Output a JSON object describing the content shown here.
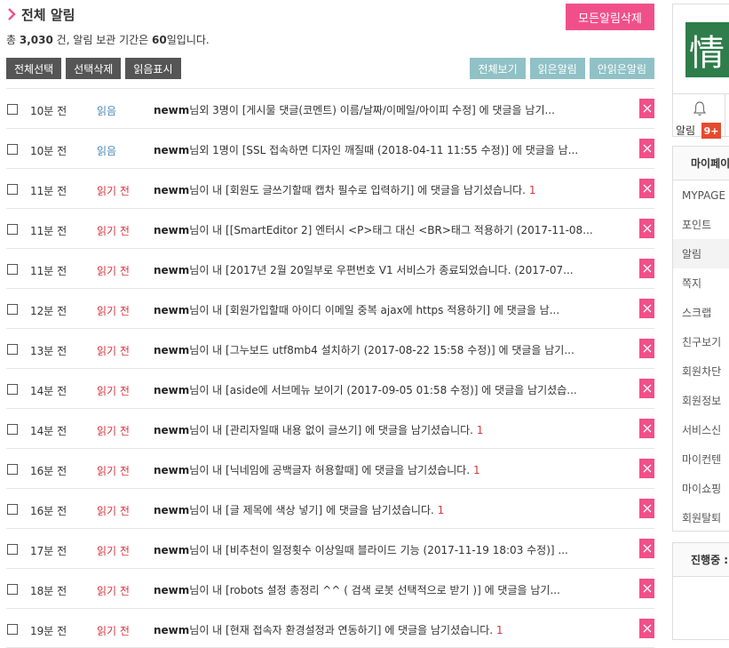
{
  "header": {
    "title": "전체 알림",
    "delete_all_label": "모든알림삭제"
  },
  "summary": {
    "prefix": "총 ",
    "count": "3,030",
    "middle": " 건, 알림 보관 기간은 ",
    "days": "60",
    "suffix": "일입니다."
  },
  "toolbar": {
    "select_all": "전체선택",
    "delete_selected": "선택삭제",
    "mark_read": "읽음표시",
    "view_all": "전체보기",
    "read_filter": "읽은알림",
    "unread_filter": "안읽은알림"
  },
  "colors": {
    "accent_pink": "#f0508a",
    "teal_button": "#8fc1c6",
    "dark_button": "#555555",
    "read_status": "#4a8ab8",
    "unread_status": "#d9363e",
    "logo_green": "#2e7d4a"
  },
  "notifications": [
    {
      "time": "10분 전",
      "status": "읽음",
      "read": true,
      "nick": "newm",
      "text": "님외 3명이 [게시물 댓글(코멘트) 이름/날짜/이메일/아이피 수정] 에 댓글을 남기...",
      "count": ""
    },
    {
      "time": "10분 전",
      "status": "읽음",
      "read": true,
      "nick": "newm",
      "text": "님외 1명이 [SSL 접속하면 디자인 깨질때 (2018-04-11 11:55 수정)] 에 댓글을 남...",
      "count": ""
    },
    {
      "time": "11분 전",
      "status": "읽기 전",
      "read": false,
      "nick": "newm",
      "text": "님이 내 [회원도 글쓰기할때 캡차 필수로 입력하기] 에 댓글을 남기셨습니다. ",
      "count": "1"
    },
    {
      "time": "11분 전",
      "status": "읽기 전",
      "read": false,
      "nick": "newm",
      "text": "님이 내 [[SmartEditor 2] 엔터시 <P>태그 대신 <BR>태그 적용하기 (2017-11-08...",
      "count": ""
    },
    {
      "time": "11분 전",
      "status": "읽기 전",
      "read": false,
      "nick": "newm",
      "text": "님이 내 [2017년 2월 20일부로 우편번호 V1 서비스가 종료되었습니다. (2017-07...",
      "count": ""
    },
    {
      "time": "12분 전",
      "status": "읽기 전",
      "read": false,
      "nick": "newm",
      "text": "님이 내 [회원가입할때 아이디 이메일 중복 ajax에 https 적용하기] 에 댓글을 남...",
      "count": ""
    },
    {
      "time": "13분 전",
      "status": "읽기 전",
      "read": false,
      "nick": "newm",
      "text": "님이 내 [그누보드 utf8mb4 설치하기 (2017-08-22 15:58 수정)] 에 댓글을 남기...",
      "count": ""
    },
    {
      "time": "14분 전",
      "status": "읽기 전",
      "read": false,
      "nick": "newm",
      "text": "님이 내 [aside에 서브메뉴 보이기 (2017-09-05 01:58 수정)] 에 댓글을 남기셨습...",
      "count": ""
    },
    {
      "time": "14분 전",
      "status": "읽기 전",
      "read": false,
      "nick": "newm",
      "text": "님이 내 [관리자일때 내용 없이 글쓰기] 에 댓글을 남기셨습니다. ",
      "count": "1"
    },
    {
      "time": "16분 전",
      "status": "읽기 전",
      "read": false,
      "nick": "newm",
      "text": "님이 내 [닉네임에 공백글자 허용할때] 에 댓글을 남기셨습니다. ",
      "count": "1"
    },
    {
      "time": "16분 전",
      "status": "읽기 전",
      "read": false,
      "nick": "newm",
      "text": "님이 내 [글 제목에 색상 넣기] 에 댓글을 남기셨습니다. ",
      "count": "1"
    },
    {
      "time": "17분 전",
      "status": "읽기 전",
      "read": false,
      "nick": "newm",
      "text": "님이 내 [비추천이 일정횟수 이상일때 블라이드 기능 (2017-11-19 18:03 수정)] ...",
      "count": ""
    },
    {
      "time": "18분 전",
      "status": "읽기 전",
      "read": false,
      "nick": "newm",
      "text": "님이 내 [robots 설정 총정리 ^^ ( 검색 로봇 선택적으로 받기 )] 에 댓글을 남기...",
      "count": ""
    },
    {
      "time": "19분 전",
      "status": "읽기 전",
      "read": false,
      "nick": "newm",
      "text": "님이 내 [현재 접속자 환경설정과 연동하기] 에 댓글을 남기셨습니다. ",
      "count": "1"
    }
  ],
  "sidebar": {
    "logo_char": "情",
    "alarm_label": "알림",
    "alarm_badge": "9+",
    "mypage_head": "마이페이",
    "items": [
      {
        "label": "MYPAGE",
        "active": false
      },
      {
        "label": "포인트",
        "active": false
      },
      {
        "label": "알림",
        "active": true
      },
      {
        "label": "쪽지",
        "active": false
      },
      {
        "label": "스크랩",
        "active": false
      },
      {
        "label": "친구보기",
        "active": false
      },
      {
        "label": "회원차단",
        "active": false
      },
      {
        "label": "회원정보",
        "active": false
      },
      {
        "label": "서비스신",
        "active": false
      },
      {
        "label": "마이컨텐",
        "active": false
      },
      {
        "label": "마이쇼핑",
        "active": false
      },
      {
        "label": "회원탈퇴",
        "active": false
      }
    ],
    "progress_head": "진행중 :"
  }
}
